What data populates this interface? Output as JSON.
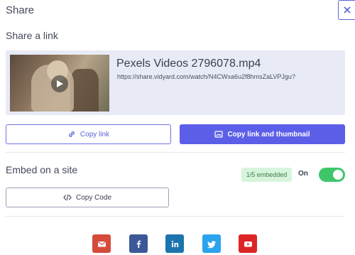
{
  "dialog": {
    "title": "Share",
    "close_icon": "close-icon"
  },
  "share_link": {
    "section_label": "Share a link",
    "video": {
      "title": "Pexels Videos 2796078.mp4",
      "url": "https://share.vidyard.com/watch/N4CWxa6u2f8hmsZaLVPJgu?",
      "thumbnail_icon": "play-icon"
    },
    "copy_link_label": "Copy link",
    "copy_thumbnail_label": "Copy link and thumbnail"
  },
  "embed": {
    "section_label": "Embed on a site",
    "embedded_badge": "1/5 embedded",
    "toggle_label": "On",
    "toggle_state": true,
    "copy_code_label": "Copy Code"
  },
  "social": [
    {
      "name": "email",
      "icon": "email-icon",
      "color": "#d44b3b"
    },
    {
      "name": "facebook",
      "icon": "facebook-icon",
      "color": "#3b5998"
    },
    {
      "name": "linkedin",
      "icon": "linkedin-icon",
      "color": "#1b74ae"
    },
    {
      "name": "twitter",
      "icon": "twitter-icon",
      "color": "#2ba3ee"
    },
    {
      "name": "youtube",
      "icon": "youtube-icon",
      "color": "#dc2626"
    }
  ],
  "colors": {
    "accent": "#5b5fe8",
    "toggle_on": "#3fc66a",
    "card_bg": "#e8ebf5"
  }
}
